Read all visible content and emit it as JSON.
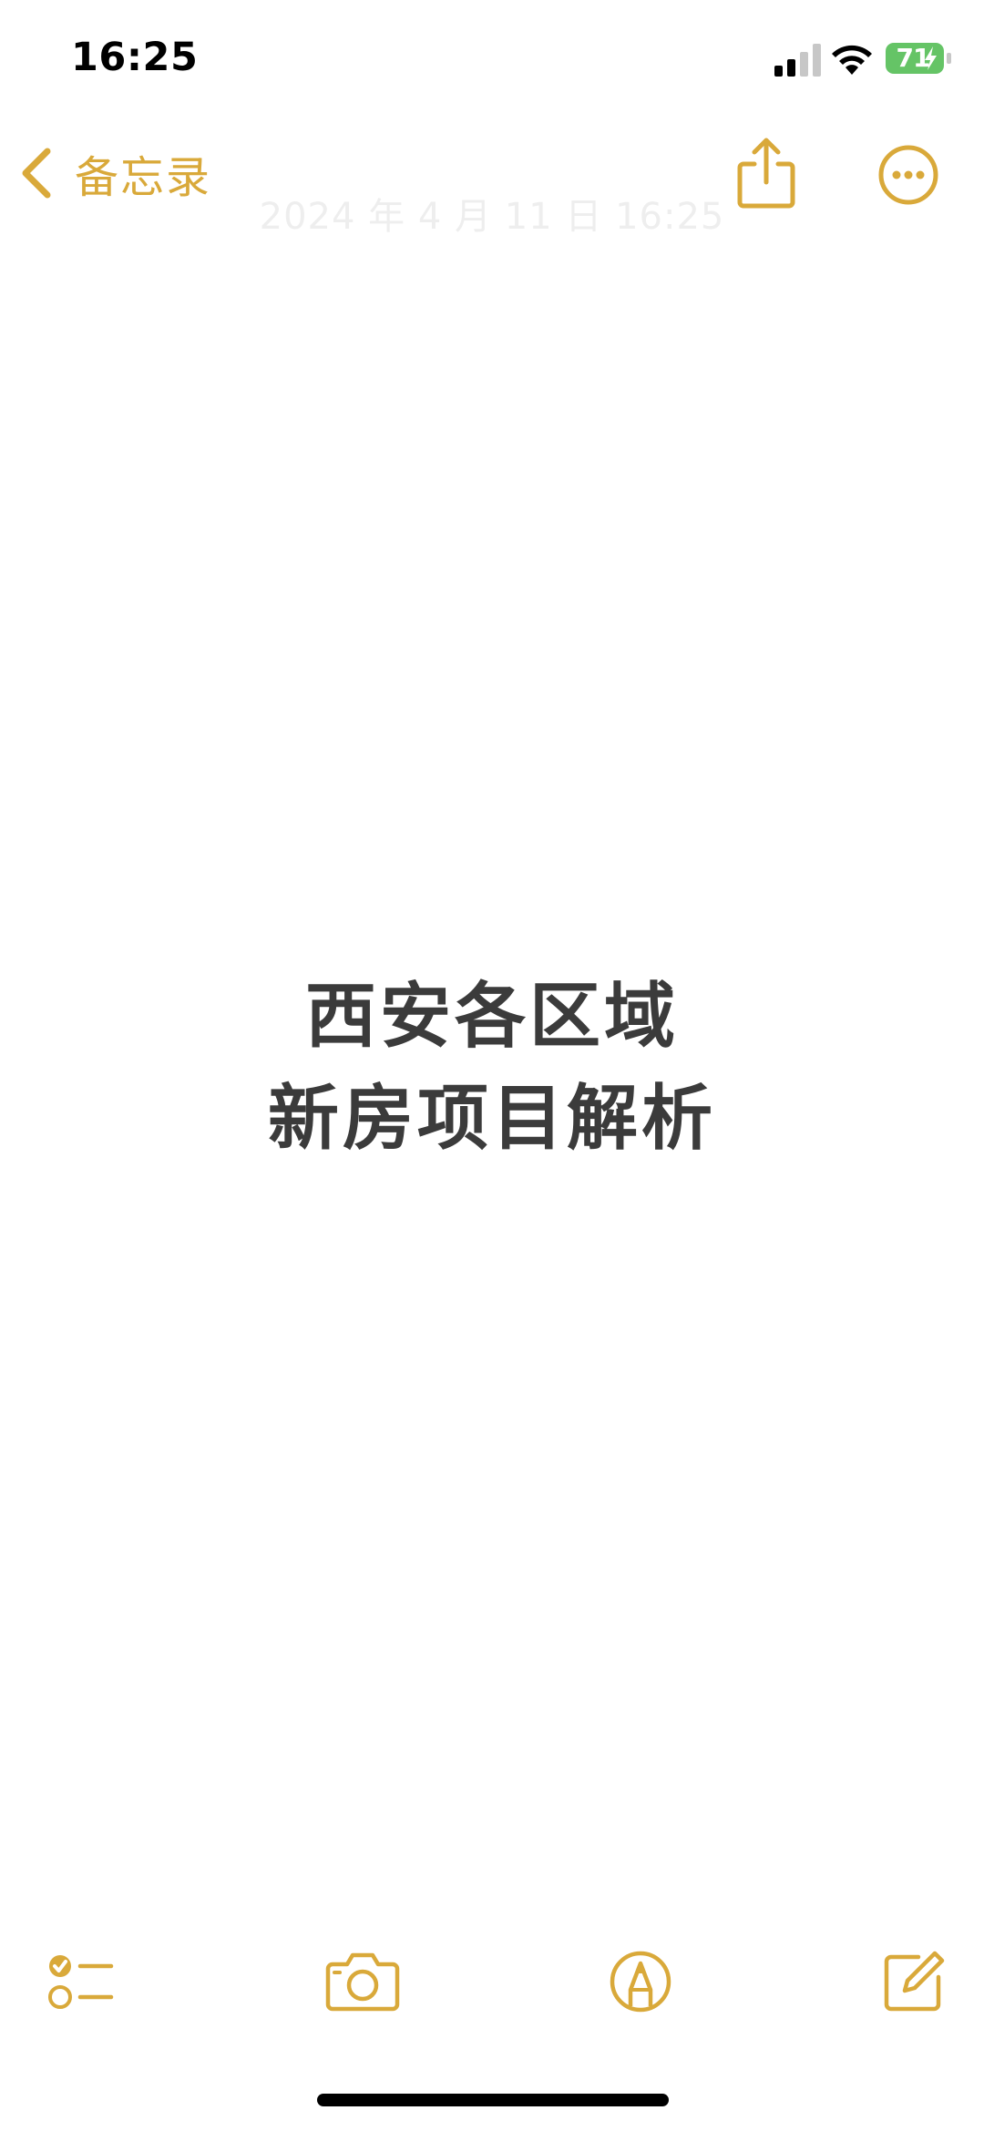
{
  "status_bar": {
    "time": "16:25",
    "battery_level": "71",
    "battery_color": "#65C466",
    "signal_icon": "cellular-signal-icon",
    "wifi_icon": "wifi-icon",
    "battery_icon": "battery-charging-icon"
  },
  "nav": {
    "back_label": "备忘录",
    "back_icon": "chevron-left-icon",
    "date": "2024 年 4 月 11 日 16:25",
    "share_icon": "share-icon",
    "more_icon": "more-ellipsis-icon",
    "accent_color": "#D9A93A"
  },
  "note": {
    "lines": [
      "西安各区域",
      "新房项目解析"
    ],
    "text_color": "#3B3B3B"
  },
  "toolbar": {
    "checklist_icon": "checklist-icon",
    "camera_icon": "camera-icon",
    "markup_icon": "markup-pen-icon",
    "compose_icon": "compose-icon"
  }
}
